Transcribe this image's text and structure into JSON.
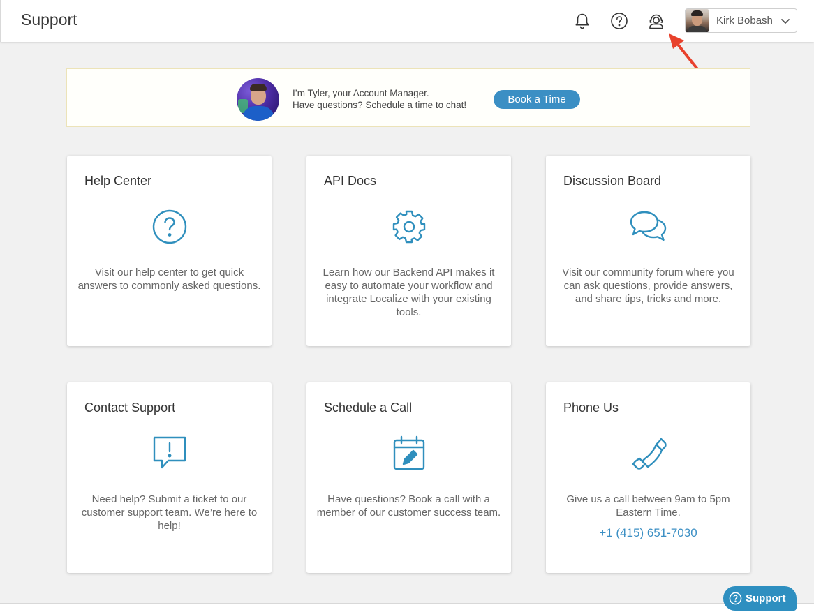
{
  "header": {
    "title": "Support",
    "icons": [
      "bell-icon",
      "help-icon",
      "account-manager-icon"
    ],
    "user": {
      "name": "Kirk Bobash"
    }
  },
  "banner": {
    "line1": "I’m Tyler, your Account Manager.",
    "line2": "Have questions? Schedule a time to chat!",
    "button_label": "Book a Time"
  },
  "cards": [
    {
      "title": "Help Center",
      "icon": "question-circle-icon",
      "description": "Visit our help center to get quick answers to commonly asked questions."
    },
    {
      "title": "API Docs",
      "icon": "gear-icon",
      "description": "Learn how our Backend API makes it easy to automate your workflow and integrate Localize with your existing tools."
    },
    {
      "title": "Discussion Board",
      "icon": "chat-bubbles-icon",
      "description": "Visit our community forum where you can ask questions, provide answers, and share tips, tricks and more."
    },
    {
      "title": "Contact Support",
      "icon": "alert-message-icon",
      "description": "Need help? Submit a ticket to our customer support team. We’re here to help!"
    },
    {
      "title": "Schedule a Call",
      "icon": "calendar-edit-icon",
      "description": "Have questions? Book a call with a member of our customer success team."
    },
    {
      "title": "Phone Us",
      "icon": "phone-icon",
      "description": "Give us a call between 9am to 5pm Eastern Time.",
      "phone": "+1 (415) 651-7030"
    }
  ],
  "support_widget": {
    "label": "Support"
  },
  "colors": {
    "accent": "#3b8fc4",
    "annotation": "#e8412c",
    "background": "#f1f1f1"
  }
}
